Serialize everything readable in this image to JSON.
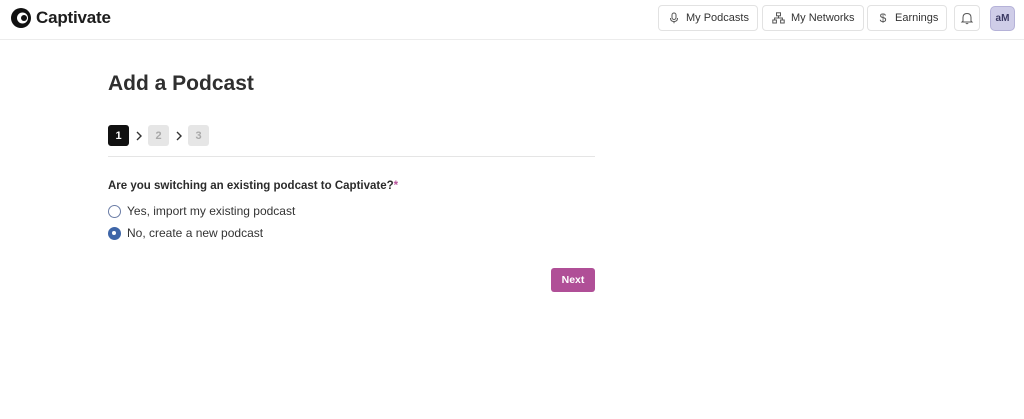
{
  "brand": {
    "name": "Captivate"
  },
  "nav": {
    "my_podcasts": "My Podcasts",
    "my_networks": "My Networks",
    "earnings": "Earnings",
    "avatar_initials": "aM"
  },
  "page": {
    "title": "Add a Podcast",
    "steps": [
      "1",
      "2",
      "3"
    ],
    "active_step": 1
  },
  "form": {
    "question": "Are you switching an existing podcast to Captivate?",
    "required_mark": "*",
    "options": [
      {
        "label": "Yes, import my existing podcast",
        "checked": false
      },
      {
        "label": "No, create a new podcast",
        "checked": true
      }
    ],
    "next_label": "Next"
  },
  "colors": {
    "accent": "#b04f97",
    "radio_selected": "#3f66a8",
    "step_active": "#111111",
    "step_inactive": "#e6e6e6"
  }
}
